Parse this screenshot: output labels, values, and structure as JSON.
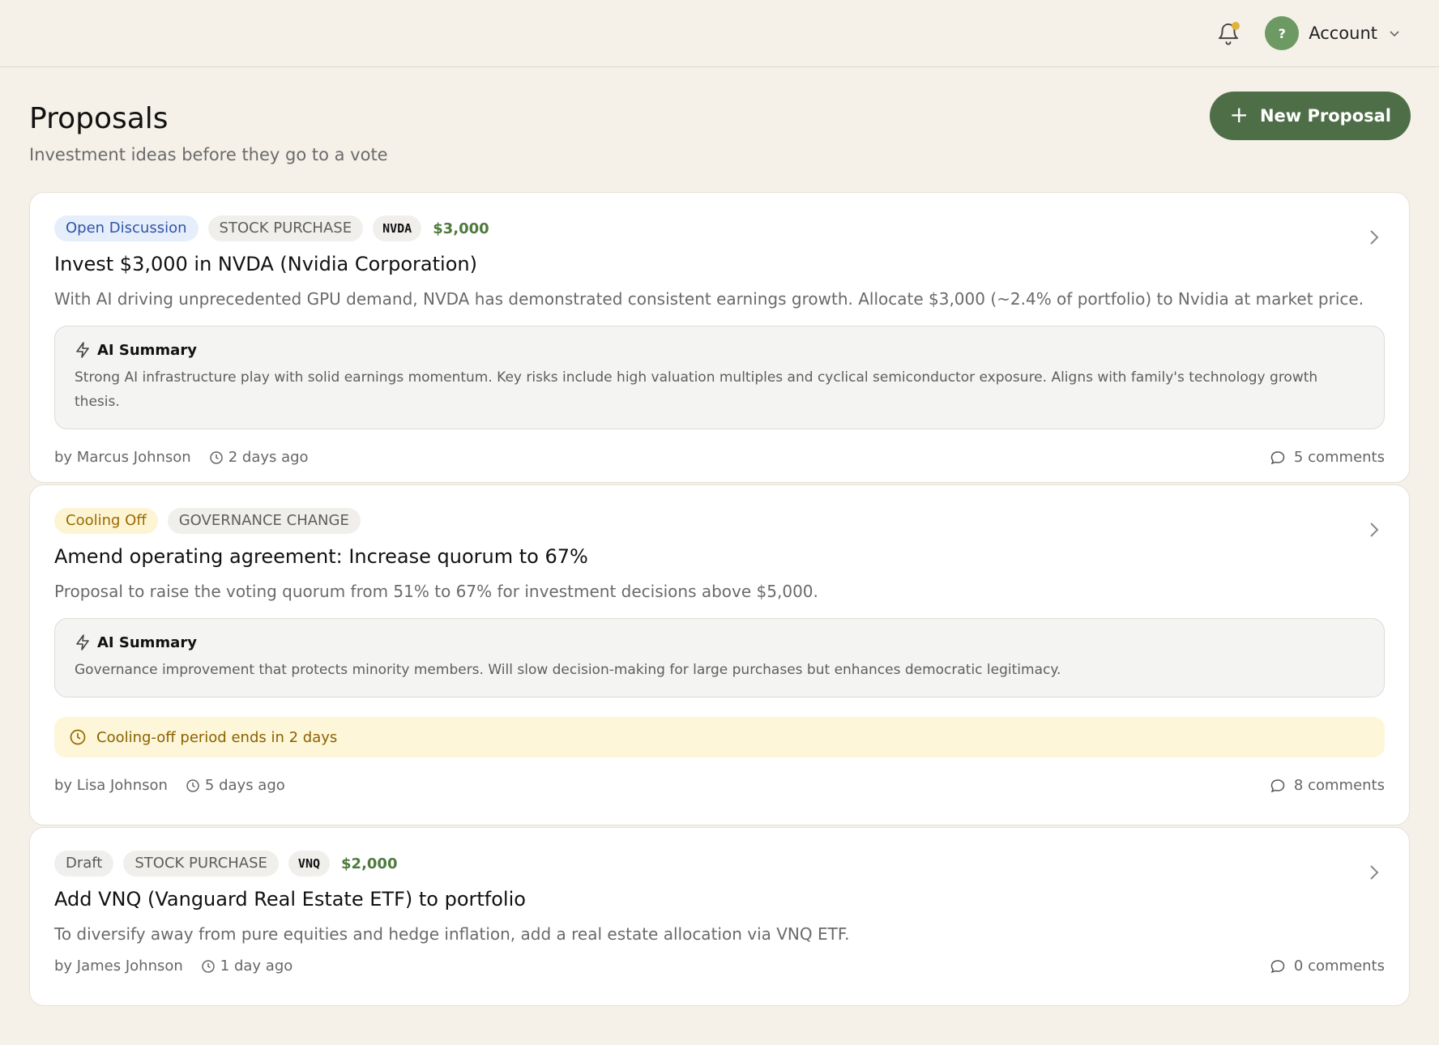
{
  "header": {
    "avatar_letter": "?",
    "account_label": "Account"
  },
  "page": {
    "title": "Proposals",
    "subtitle": "Investment ideas before they go to a vote",
    "new_button_label": "New Proposal"
  },
  "proposals": [
    {
      "status": "Open Discussion",
      "type": "STOCK PURCHASE",
      "ticker": "NVDA",
      "amount": "$3,000",
      "title": "Invest $3,000 in NVDA (Nvidia Corporation)",
      "description": "With AI driving unprecedented GPU demand, NVDA has demonstrated consistent earnings growth. Allocate $3,000 (~2.4% of portfolio) to Nvidia at market price.",
      "ai_summary_label": "AI Summary",
      "ai_summary": "Strong AI infrastructure play with solid earnings momentum. Key risks include high valuation multiples and cyclical semiconductor exposure. Aligns with family's technology growth thesis.",
      "author": "by Marcus Johnson",
      "time": "2 days ago",
      "comments": "5 comments"
    },
    {
      "status": "Cooling Off",
      "type": "GOVERNANCE CHANGE",
      "title": "Amend operating agreement: Increase quorum to 67%",
      "description": "Proposal to raise the voting quorum from 51% to 67% for investment decisions above $5,000.",
      "ai_summary_label": "AI Summary",
      "ai_summary": "Governance improvement that protects minority members. Will slow decision-making for large purchases but enhances democratic legitimacy.",
      "cooling_notice": "Cooling-off period ends in 2 days",
      "author": "by Lisa Johnson",
      "time": "5 days ago",
      "comments": "8 comments"
    },
    {
      "status": "Draft",
      "type": "STOCK PURCHASE",
      "ticker": "VNQ",
      "amount": "$2,000",
      "title": "Add VNQ (Vanguard Real Estate ETF) to portfolio",
      "description": "To diversify away from pure equities and hedge inflation, add a real estate allocation via VNQ ETF.",
      "author": "by James Johnson",
      "time": "1 day ago",
      "comments": "0 comments"
    }
  ],
  "colors": {
    "background": "#f5f1e8",
    "primary_button": "#4e6e48",
    "avatar": "#6d9963",
    "notification_dot": "#e0b43a",
    "amount": "#4e7a3e"
  }
}
